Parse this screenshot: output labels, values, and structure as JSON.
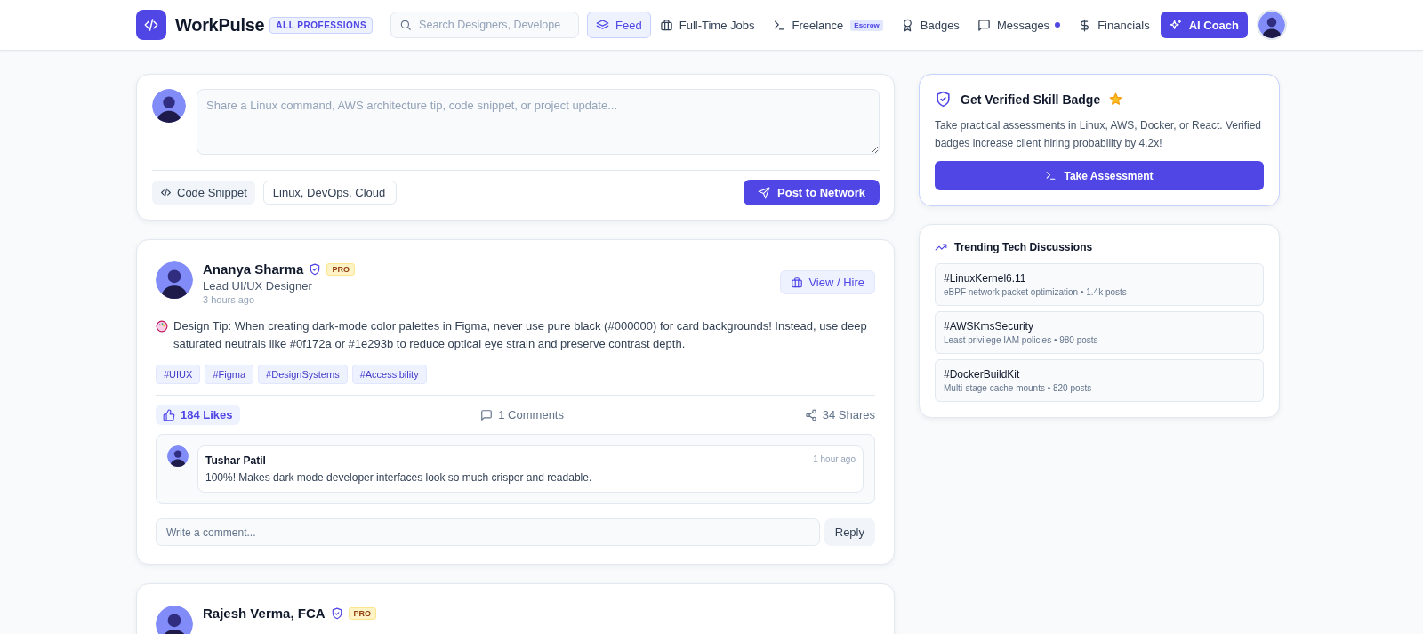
{
  "header": {
    "brand": "WorkPulse",
    "scope_badge": "ALL PROFESSIONS",
    "search": {
      "placeholder": "Search Designers, Develope"
    },
    "nav": [
      {
        "label": "Feed",
        "kind": "link",
        "selected": true
      },
      {
        "label": "Full-Time Jobs",
        "kind": "link",
        "selected": false
      },
      {
        "label": "Freelance",
        "kind": "link",
        "selected": false,
        "tag": "Escrow"
      },
      {
        "label": "Badges",
        "kind": "link",
        "selected": false
      },
      {
        "label": "Messages",
        "kind": "link",
        "selected": false,
        "unread": true
      },
      {
        "label": "Financials",
        "kind": "link",
        "selected": false
      },
      {
        "label": "AI Coach",
        "kind": "primary",
        "selected": false
      }
    ]
  },
  "composer": {
    "placeholder": "Share a Linux command, AWS architecture tip, code snippet, or project update...",
    "snippet_button": "Code Snippet",
    "tags_value": "Linux, DevOps, Cloud",
    "post_button": "Post to Network"
  },
  "posts": [
    {
      "author": "Ananya Sharma",
      "verified": true,
      "badge": "PRO",
      "role": "Lead UI/UX Designer",
      "time": "3 hours ago",
      "action": "View / Hire",
      "content": "Design Tip: When creating dark-mode color palettes in Figma, never use pure black (#000000) for card backgrounds! Instead, use deep saturated neutrals like #0f172a or #1e293b to reduce optical eye strain and preserve contrast depth.",
      "hashtags": [
        "#UIUX",
        "#Figma",
        "#DesignSystems",
        "#Accessibility"
      ],
      "likes": "184 Likes",
      "liked": true,
      "comments_count": "1 Comments",
      "shares": "34 Shares",
      "comments": [
        {
          "author": "Tushar Patil",
          "time": "1 hour ago",
          "text": "100%! Makes dark mode developer interfaces look so much crisper and readable."
        }
      ],
      "reply_placeholder": "Write a comment...",
      "reply_button": "Reply"
    },
    {
      "author": "Rajesh Verma, FCA",
      "verified": true,
      "badge": "PRO"
    }
  ],
  "sidebar": {
    "promo": {
      "title": "Get Verified Skill Badge",
      "text": "Take practical assessments in Linux, AWS, Docker, or React. Verified badges increase client hiring probability by 4.2x!",
      "button": "Take Assessment"
    },
    "trending": {
      "title": "Trending Tech Discussions",
      "items": [
        {
          "tag": "#LinuxKernel6.11",
          "meta": "eBPF network packet optimization • 1.4k posts"
        },
        {
          "tag": "#AWSKmsSecurity",
          "meta": "Least privilege IAM policies • 980 posts"
        },
        {
          "tag": "#DockerBuildKit",
          "meta": "Multi-stage cache mounts • 820 posts"
        }
      ]
    }
  }
}
